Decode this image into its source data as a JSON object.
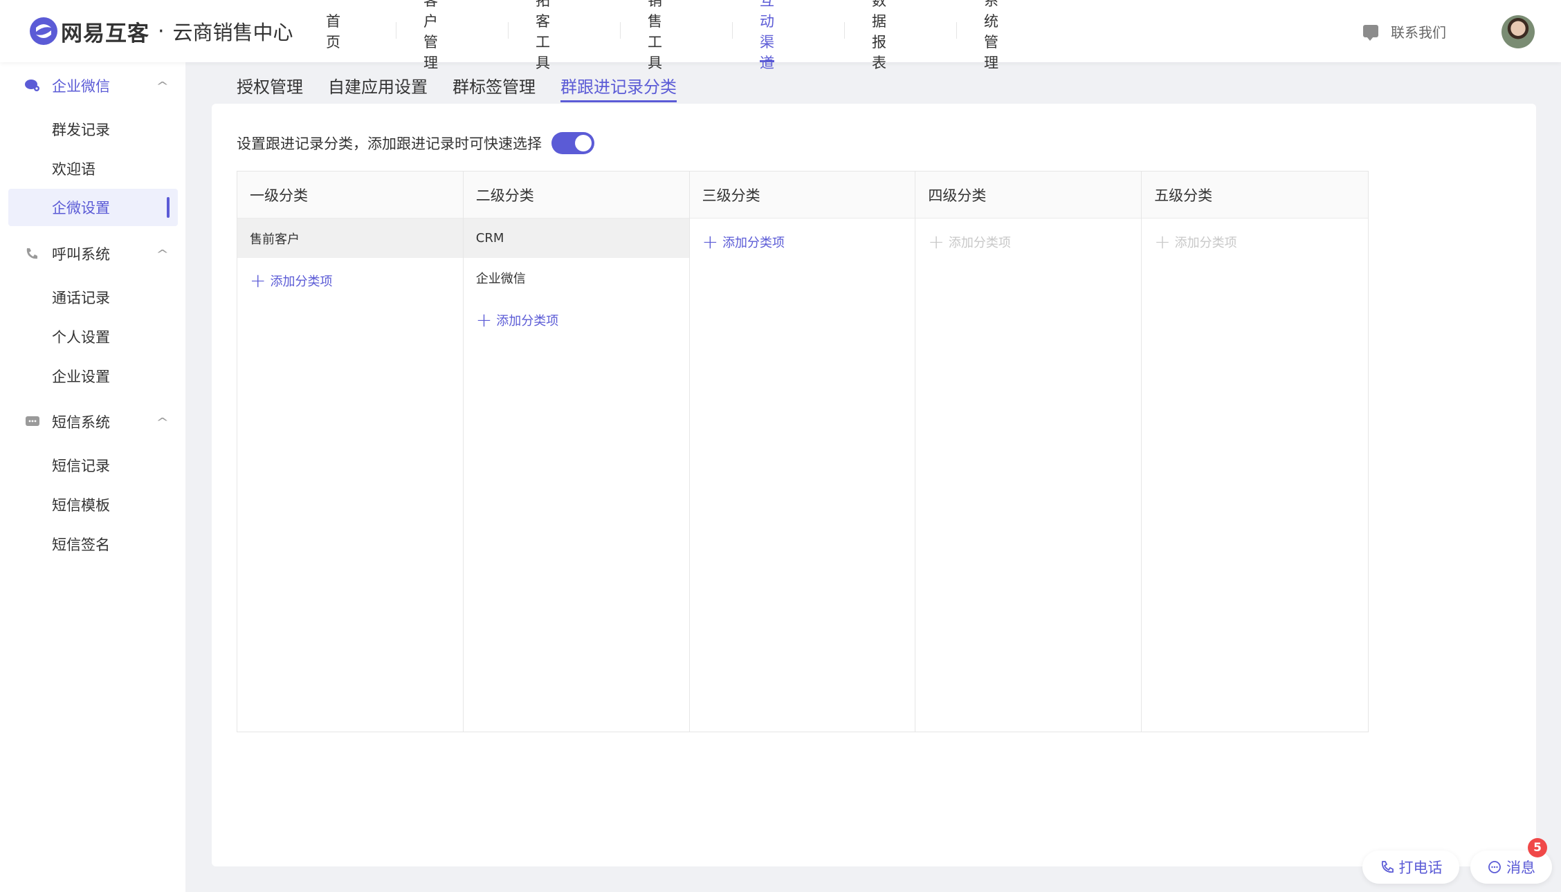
{
  "header": {
    "logo_text": "网易互客",
    "logo_dot": "·",
    "logo_sub": "云商销售中心",
    "nav": [
      {
        "label": "首页",
        "active": false
      },
      {
        "label": "客户管理",
        "active": false
      },
      {
        "label": "拓客工具",
        "active": false
      },
      {
        "label": "销售工具",
        "active": false
      },
      {
        "label": "互动渠道",
        "active": true
      },
      {
        "label": "数据报表",
        "active": false
      },
      {
        "label": "系统管理",
        "active": false
      }
    ],
    "contact": "联系我们"
  },
  "sidebar": {
    "groups": [
      {
        "label": "企业微信",
        "items": [
          "群发记录",
          "欢迎语",
          "企微设置"
        ]
      },
      {
        "label": "呼叫系统",
        "items": [
          "通话记录",
          "个人设置",
          "企业设置"
        ]
      },
      {
        "label": "短信系统",
        "items": [
          "短信记录",
          "短信模板",
          "短信签名"
        ]
      }
    ],
    "active_item": "企微设置"
  },
  "subtabs": [
    "授权管理",
    "自建应用设置",
    "群标签管理",
    "群跟进记录分类"
  ],
  "active_subtab": "群跟进记录分类",
  "setting": {
    "text": "设置跟进记录分类，添加跟进记录时可快速选择",
    "enabled": true
  },
  "columns": [
    {
      "title": "一级分类",
      "rows": [
        "售前客户"
      ],
      "selected": "售前客户",
      "add": "添加分类项",
      "disabled": false
    },
    {
      "title": "二级分类",
      "rows": [
        "CRM",
        "企业微信"
      ],
      "selected": "CRM",
      "add": "添加分类项",
      "disabled": false
    },
    {
      "title": "三级分类",
      "rows": [],
      "selected": null,
      "add": "添加分类项",
      "disabled": false
    },
    {
      "title": "四级分类",
      "rows": [],
      "selected": null,
      "add": "添加分类项",
      "disabled": true
    },
    {
      "title": "五级分类",
      "rows": [],
      "selected": null,
      "add": "添加分类项",
      "disabled": true
    }
  ],
  "float": {
    "call": "打电话",
    "message": "消息",
    "badge": "5"
  },
  "colors": {
    "accent": "#5b5bd6",
    "badge": "#f04848"
  }
}
